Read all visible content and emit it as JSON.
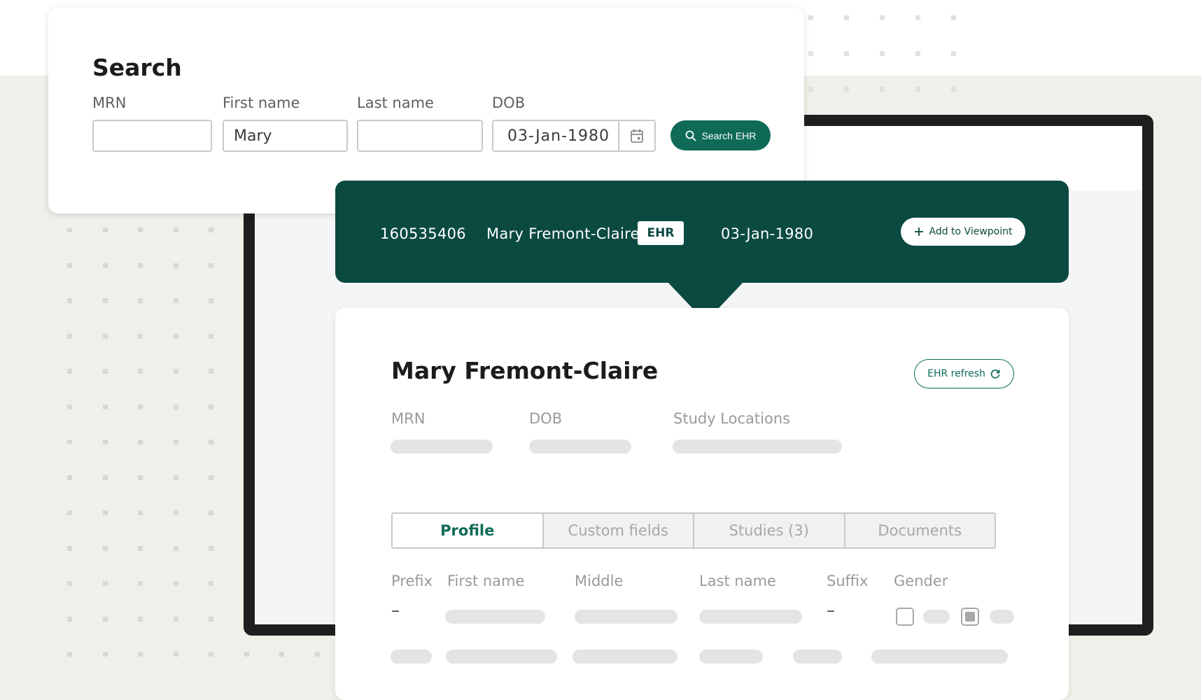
{
  "search_form": {
    "title": "Search",
    "fields": {
      "mrn": {
        "label": "MRN",
        "value": ""
      },
      "first_name": {
        "label": "First name",
        "value": "Mary"
      },
      "last_name": {
        "label": "Last name",
        "value": ""
      },
      "dob": {
        "label": "DOB",
        "value": "03-Jan-1980"
      }
    },
    "search_button_label": "Search EHR"
  },
  "result": {
    "mrn": "160535406",
    "name": "Mary Fremont-Claire",
    "source_badge": "EHR",
    "dob": "03-Jan-1980",
    "add_button_label": "Add to Viewpoint"
  },
  "patient_card": {
    "name": "Mary Fremont-Claire",
    "refresh_button_label": "EHR refresh",
    "meta_labels": {
      "mrn": "MRN",
      "dob": "DOB",
      "study_locations": "Study Locations"
    },
    "tabs": [
      {
        "label": "Profile",
        "active": true
      },
      {
        "label": "Custom fields",
        "active": false
      },
      {
        "label": "Studies (3)",
        "active": false
      },
      {
        "label": "Documents",
        "active": false
      }
    ],
    "columns": {
      "prefix": "Prefix",
      "first_name": "First name",
      "middle": "Middle",
      "last_name": "Last name",
      "suffix": "Suffix",
      "gender": "Gender"
    },
    "prefix_value": "–",
    "suffix_value": "–"
  },
  "colors": {
    "primary": "#0f6b58",
    "banner": "#0b4a40",
    "background": "#f1efe9"
  },
  "icons": [
    "search-icon",
    "calendar-icon",
    "plus-icon",
    "refresh-icon"
  ]
}
